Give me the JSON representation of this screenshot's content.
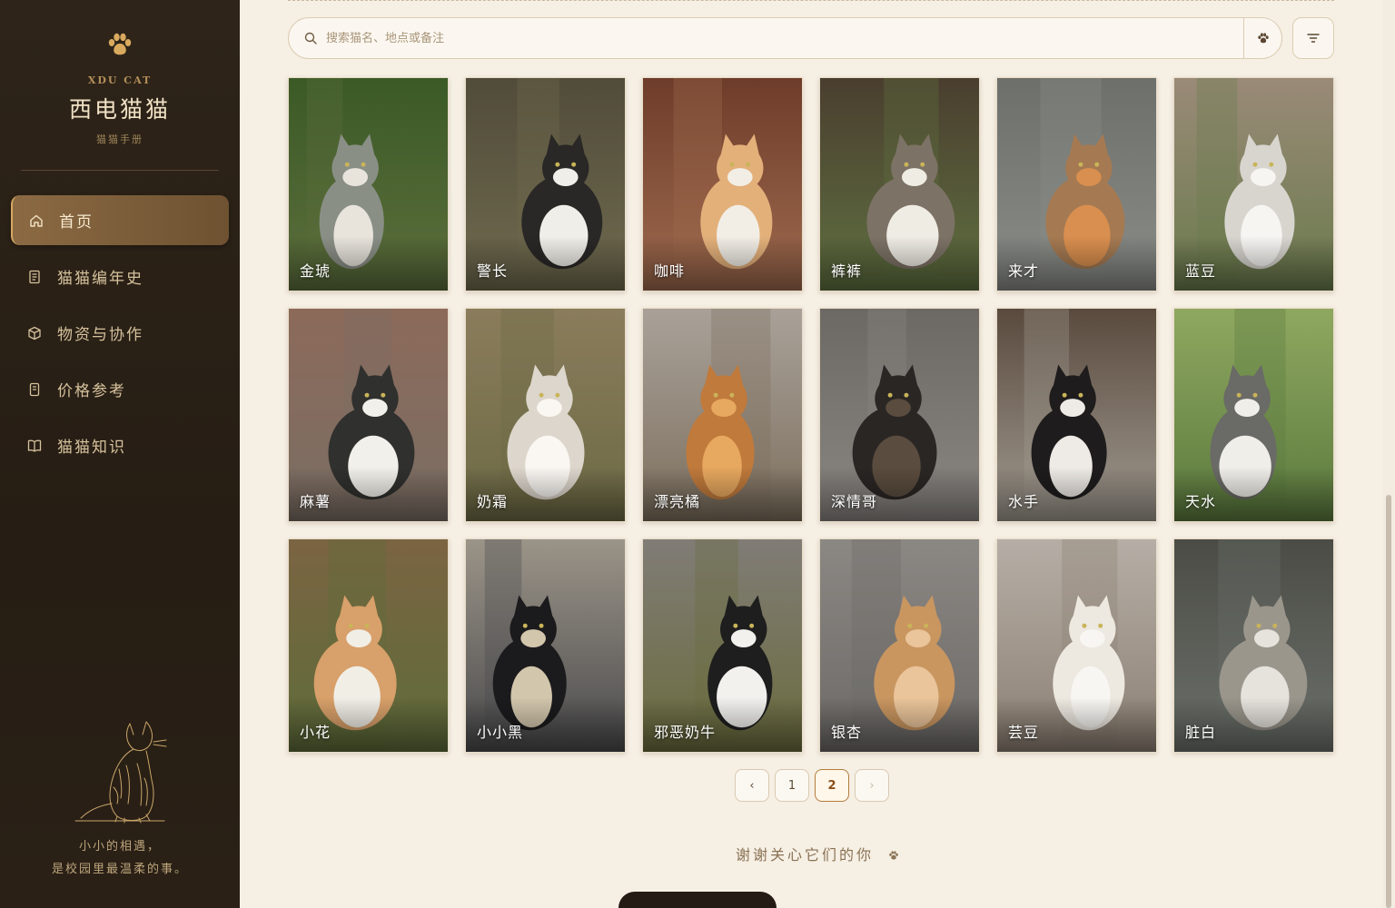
{
  "brand": {
    "en": "XDU CAT",
    "title": "西电猫猫",
    "subtitle": "猫猫手册"
  },
  "nav": [
    {
      "label": "首页",
      "icon": "home-icon",
      "active": true
    },
    {
      "label": "猫猫编年史",
      "icon": "document-icon",
      "active": false
    },
    {
      "label": "物资与协作",
      "icon": "box-icon",
      "active": false
    },
    {
      "label": "价格参考",
      "icon": "receipt-icon",
      "active": false
    },
    {
      "label": "猫猫知识",
      "icon": "book-icon",
      "active": false
    }
  ],
  "footer": {
    "line1": "小小的相遇，",
    "line2": "是校园里最温柔的事。"
  },
  "search": {
    "placeholder": "搜索猫名、地点或备注",
    "value": ""
  },
  "cats": [
    {
      "name": "金琥",
      "palette": [
        "#5c6e3c",
        "#3b5a26",
        "#8a8f86",
        "#e8e4dc"
      ]
    },
    {
      "name": "警长",
      "palette": [
        "#6f6a4e",
        "#514c3a",
        "#2a2826",
        "#f0eee8"
      ]
    },
    {
      "name": "咖啡",
      "palette": [
        "#9e6a4e",
        "#6e3c2a",
        "#e3b07a",
        "#f2eee6"
      ]
    },
    {
      "name": "裤裤",
      "palette": [
        "#5f7040",
        "#4a3e2f",
        "#7d7266",
        "#efece4"
      ]
    },
    {
      "name": "来才",
      "palette": [
        "#8a8c88",
        "#6d6f6b",
        "#a57a52",
        "#d98f4f"
      ]
    },
    {
      "name": "蓝豆",
      "palette": [
        "#6a7b4c",
        "#9a8a78",
        "#d8d5cf",
        "#f6f5f2"
      ]
    },
    {
      "name": "麻薯",
      "palette": [
        "#7a6e64",
        "#8c6a5a",
        "#30302e",
        "#f2f0ea"
      ]
    },
    {
      "name": "奶霜",
      "palette": [
        "#6d6a45",
        "#8a7c5c",
        "#ddd6cc",
        "#faf7f2"
      ]
    },
    {
      "name": "漂亮橘",
      "palette": [
        "#7d705e",
        "#a9a199",
        "#c07a3c",
        "#e7a85f"
      ]
    },
    {
      "name": "深情哥",
      "palette": [
        "#8a8682",
        "#6c6864",
        "#2a2624",
        "#5a4c3e"
      ]
    },
    {
      "name": "水手",
      "palette": [
        "#a09a90",
        "#5a4a3e",
        "#1e1c1c",
        "#eeebe6"
      ]
    },
    {
      "name": "天水",
      "palette": [
        "#5b7a3e",
        "#8fa860",
        "#6a6a66",
        "#f0eee9"
      ]
    },
    {
      "name": "小花",
      "palette": [
        "#5e6c3a",
        "#7b6442",
        "#d8a06a",
        "#f1eee6"
      ]
    },
    {
      "name": "小小黑",
      "palette": [
        "#4a4a4c",
        "#9b9488",
        "#1b1a1c",
        "#d2c6ac"
      ]
    },
    {
      "name": "邪恶奶牛",
      "palette": [
        "#6b6c3e",
        "#807c76",
        "#1e1e1e",
        "#f2f1ee"
      ]
    },
    {
      "name": "银杏",
      "palette": [
        "#6c6966",
        "#8b8884",
        "#c99660",
        "#eac49a"
      ]
    },
    {
      "name": "芸豆",
      "palette": [
        "#8c8074",
        "#b6aea6",
        "#ede8e0",
        "#f8f6f2"
      ]
    },
    {
      "name": "脏白",
      "palette": [
        "#6b706a",
        "#4c4c46",
        "#9a968c",
        "#e6e3dd"
      ]
    }
  ],
  "pagination": {
    "prev": "‹",
    "pages": [
      "1",
      "2"
    ],
    "current": "2",
    "next": "›"
  },
  "thanks": "谢谢关心它们的你"
}
